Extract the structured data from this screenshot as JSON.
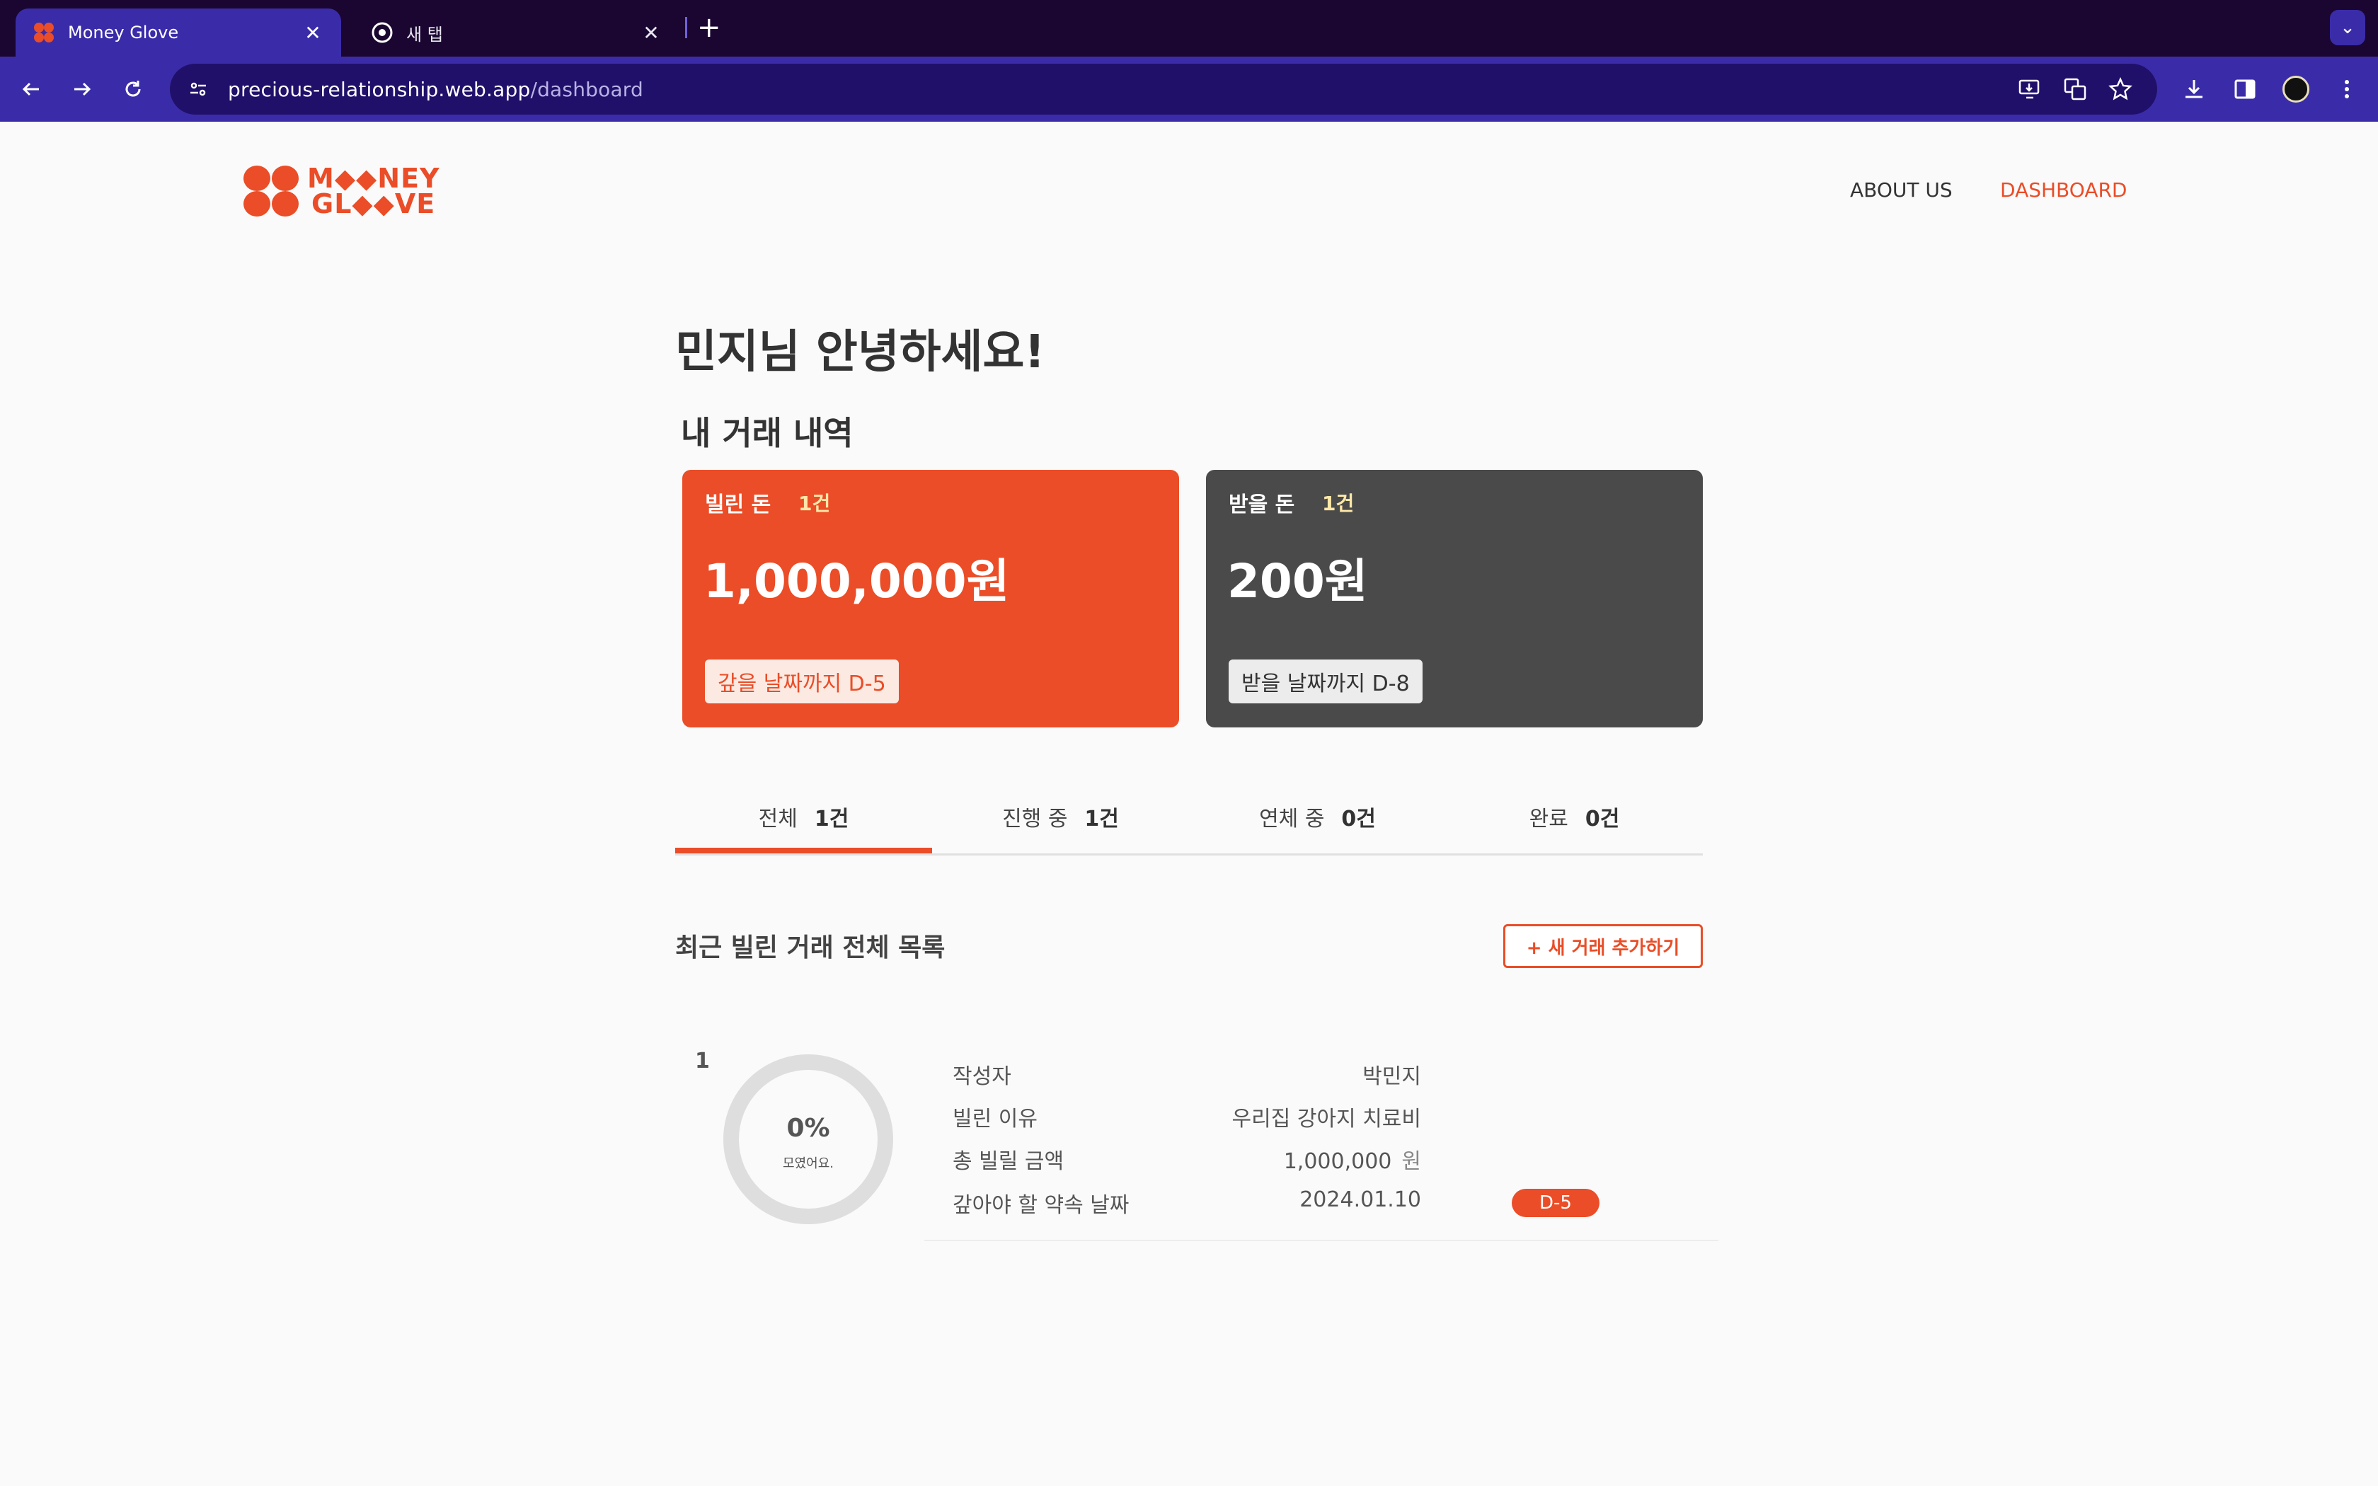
{
  "browser": {
    "tabs": [
      {
        "title": "Money Glove",
        "active": true
      },
      {
        "title": "새 탭",
        "active": false
      }
    ],
    "url_host": "precious-relationship.web.app",
    "url_path": "/dashboard",
    "colors": {
      "tabbar": "#1a0630",
      "toolbar": "#3a2ca8",
      "accent": "#ea4d27"
    }
  },
  "header": {
    "logo_text_line1": "M◆◆NEY",
    "logo_text_line2": "GL◆◆VE",
    "nav": [
      {
        "label": "ABOUT US",
        "active": false
      },
      {
        "label": "DASHBOARD",
        "active": true
      }
    ]
  },
  "greeting": "민지님 안녕하세요!",
  "section_title": "내 거래 내역",
  "cards": {
    "borrow": {
      "label": "빌린 돈",
      "count": "1건",
      "amount": "1,000,000원",
      "due": "갚을 날짜까지 D-5"
    },
    "receive": {
      "label": "받을 돈",
      "count": "1건",
      "amount": "200원",
      "due": "받을 날짜까지 D-8"
    }
  },
  "filter_tabs": [
    {
      "label": "전체",
      "count": "1건",
      "active": true
    },
    {
      "label": "진행 중",
      "count": "1건",
      "active": false
    },
    {
      "label": "연체 중",
      "count": "0건",
      "active": false
    },
    {
      "label": "완료",
      "count": "0건",
      "active": false
    }
  ],
  "list": {
    "title": "최근 빌린 거래 전체 목록",
    "add_button": "+ 새 거래 추가하기",
    "items": [
      {
        "index": "1",
        "progress_percent": "0%",
        "progress_caption": "모였어요.",
        "author_label": "작성자",
        "author": "박민지",
        "reason_label": "빌린 이유",
        "reason": "우리집 강아지 치료비",
        "amount_label": "총 빌릴 금액",
        "amount": "1,000,000",
        "amount_unit": "원",
        "due_label": "갚아야 할 약속 날짜",
        "due_date": "2024.01.10",
        "dday": "D-5"
      }
    ]
  }
}
